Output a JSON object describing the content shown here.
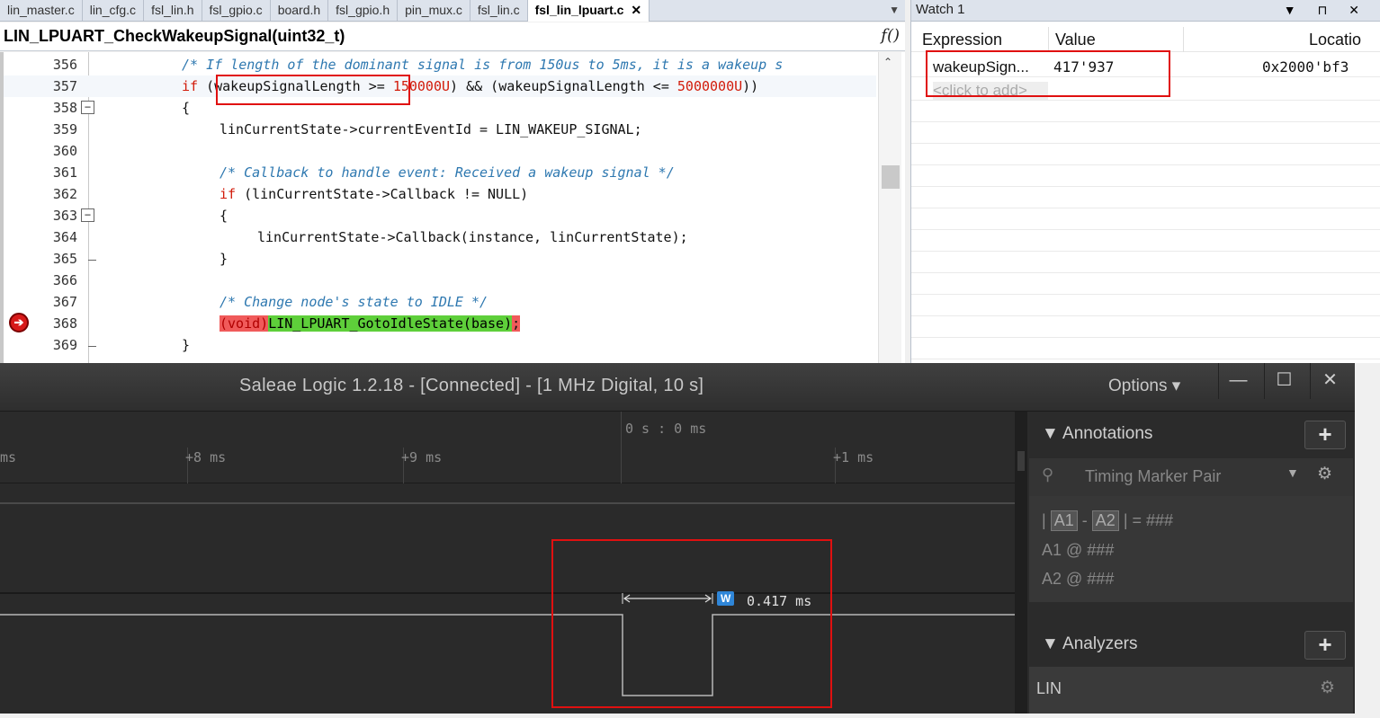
{
  "tabs": [
    {
      "label": "lin_master.c"
    },
    {
      "label": "lin_cfg.c"
    },
    {
      "label": "fsl_lin.h"
    },
    {
      "label": "fsl_gpio.c"
    },
    {
      "label": "board.h"
    },
    {
      "label": "fsl_gpio.h"
    },
    {
      "label": "pin_mux.c"
    },
    {
      "label": "fsl_lin.c"
    },
    {
      "label": "fsl_lin_lpuart.c"
    }
  ],
  "tab_close": "✕",
  "tab_dropdown": "▼",
  "function_bar": {
    "name": "LIN_LPUART_CheckWakeupSignal(uint32_t)",
    "fx": "f()"
  },
  "code": {
    "line_numbers": [
      "356",
      "357",
      "358",
      "359",
      "360",
      "361",
      "362",
      "363",
      "364",
      "365",
      "366",
      "367",
      "368",
      "369"
    ],
    "l356": "/* If length of the dominant signal is from 150us to 5ms, it is a wakeup s",
    "l357_kw": "if",
    "l357_a": "(wakeupSignalLength ",
    "l357_b": ">= ",
    "l357_n1": "150000U",
    "l357_c": ") && (wakeupSignalLength <= ",
    "l357_n2": "5000000U",
    "l357_d": "))",
    "l358": "{",
    "l359": "linCurrentState->currentEventId = LIN_WAKEUP_SIGNAL;",
    "l361": "/* Callback to handle event: Received a wakeup signal */",
    "l362_kw": "if",
    "l362_rest": " (linCurrentState->Callback != NULL)",
    "l363": "{",
    "l364": "linCurrentState->Callback(instance, linCurrentState);",
    "l365": "}",
    "l367": "/* Change node's state to IDLE */",
    "l368_void": "(void)",
    "l368_call": "LIN_LPUART_GotoIdleState(base)",
    "l368_end": ";",
    "l369": "}"
  },
  "watch": {
    "title": "Watch 1",
    "controls": "▼ ⊓ ✕",
    "headers": {
      "expression": "Expression",
      "value": "Value",
      "location": "Locatio"
    },
    "rows": [
      {
        "expression": "wakeupSign...",
        "value": "417'937",
        "location": "0x2000'bf3"
      }
    ],
    "add_row": "<click to add>"
  },
  "saleae": {
    "title": "Saleae Logic 1.2.18 - [Connected] - [1 MHz Digital, 10 s]",
    "options": "Options ▾",
    "window_buttons": [
      "—",
      "☐",
      "✕"
    ],
    "time_origin": "0 s : 0 ms",
    "ticks": [
      "ms",
      "+8 ms",
      "+9 ms",
      "+1 ms"
    ],
    "measurement_badge": "W",
    "measurement": "0.417 ms",
    "panel": {
      "annotations_title": "▼ Annotations",
      "add": "+",
      "timing_marker": "Timing Marker Pair",
      "tm_down": "▼",
      "gear": "⚙",
      "pin": "⚲",
      "row1_pre": "|",
      "row1_a1": "A1",
      "row1_dash": "-",
      "row1_a2": "A2",
      "row1_post": "| = ###",
      "row2": "A1  @  ###",
      "row3": "A2  @  ###",
      "analyzers_title": "▼ Analyzers",
      "analyzer_item": "LIN"
    }
  },
  "colors": {
    "highlight_box": "#e01010",
    "keyword": "#d21b0a",
    "comment": "#2e78b0",
    "exec_line": "#5ecf3a"
  }
}
